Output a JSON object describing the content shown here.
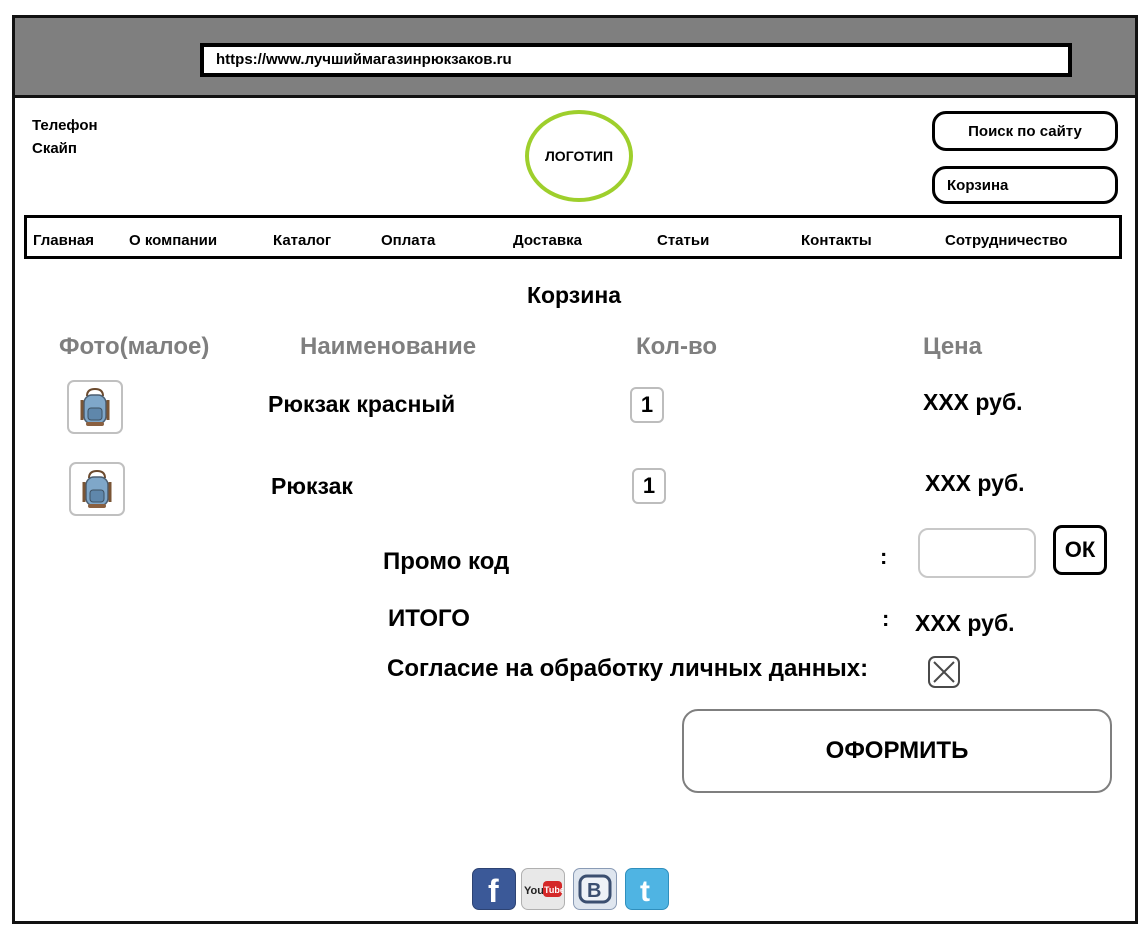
{
  "browser": {
    "url": "https://www.лучшиймагазинрюкзаков.ru"
  },
  "header": {
    "contact_phone": "Телефон",
    "contact_skype": "Скайп",
    "logo_label": "ЛОГОТИП",
    "search_label": "Поиск по сайту",
    "cart_label": "Корзина"
  },
  "nav": {
    "items": [
      "Главная",
      "О компании",
      "Каталог",
      "Оплата",
      "Доставка",
      "Статьи",
      "Контакты",
      "Сотрудничество"
    ]
  },
  "cart_page": {
    "title": "Корзина",
    "columns": [
      "Фото(малое)",
      "Наименование",
      "Кол-во",
      "Цена"
    ],
    "rows": [
      {
        "name": "Рюкзак красный",
        "qty": "1",
        "price": "XXX руб."
      },
      {
        "name": "Рюкзак",
        "qty": "1",
        "price": "XXX руб."
      }
    ],
    "promo_label": "Промо код",
    "promo_colon": ":",
    "promo_value": "",
    "ok_label": "ОК",
    "total_label": "ИТОГО",
    "total_colon": ":",
    "total_value": "XXX руб.",
    "consent_label": "Согласие на обработку личных данных:",
    "submit_label": "ОФОРМИТЬ"
  },
  "social": [
    "facebook-icon",
    "youtube-icon",
    "vk-icon",
    "twitter-icon"
  ],
  "colors": {
    "logo_ring": "#9ecf2c",
    "browser_bar": "#7f7f7f",
    "header_text_gray": "#7f7f7f"
  }
}
